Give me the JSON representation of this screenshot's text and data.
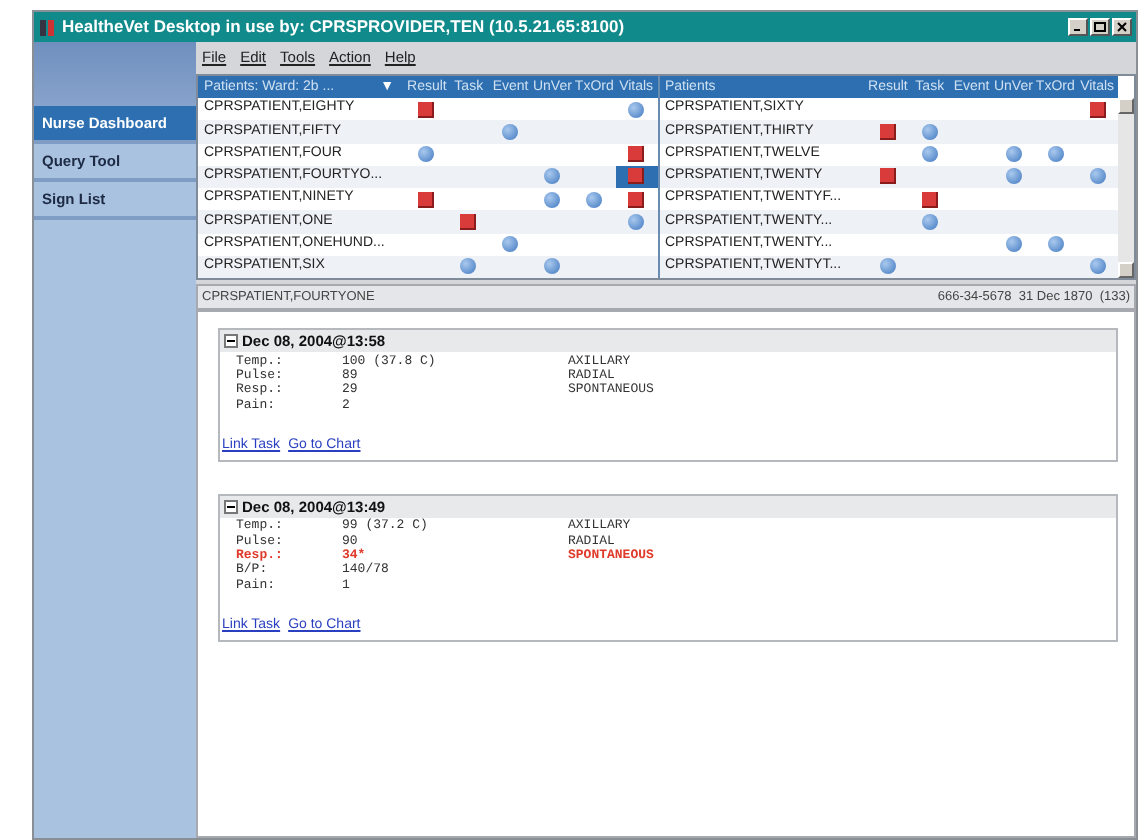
{
  "window": {
    "title": "HealtheVet Desktop in use by: CPRSPROVIDER,TEN (10.5.21.65:8100)"
  },
  "menu": [
    "File",
    "Edit",
    "Tools",
    "Action",
    "Help"
  ],
  "sidebar": {
    "items": [
      {
        "label": "Nurse Dashboard",
        "selected": true
      },
      {
        "label": "Query Tool",
        "selected": false
      },
      {
        "label": "Sign List",
        "selected": false
      }
    ]
  },
  "patient_grid": {
    "panels": [
      {
        "heading": "Patients: Ward: 2b ...",
        "dropdown": "▼",
        "columns": [
          "Result",
          "Task",
          "Event",
          "UnVer",
          "TxOrd",
          "Vitals"
        ],
        "rows": [
          {
            "name": "CPRSPATIENT,EIGHTY",
            "selected": false,
            "cells": [
              {
                "kind": "alert"
              },
              {
                "kind": "empty"
              },
              {
                "kind": "empty"
              },
              {
                "kind": "empty"
              },
              {
                "kind": "empty"
              },
              {
                "kind": "normal"
              }
            ]
          },
          {
            "name": "CPRSPATIENT,FIFTY",
            "selected": false,
            "cells": [
              {
                "kind": "empty"
              },
              {
                "kind": "empty"
              },
              {
                "kind": "normal"
              },
              {
                "kind": "empty"
              },
              {
                "kind": "empty"
              },
              {
                "kind": "empty"
              }
            ]
          },
          {
            "name": "CPRSPATIENT,FOUR",
            "selected": false,
            "cells": [
              {
                "kind": "normal"
              },
              {
                "kind": "empty"
              },
              {
                "kind": "empty"
              },
              {
                "kind": "empty"
              },
              {
                "kind": "empty"
              },
              {
                "kind": "alert"
              }
            ]
          },
          {
            "name": "CPRSPATIENT,FOURTYO...",
            "selected": true,
            "cells": [
              {
                "kind": "empty"
              },
              {
                "kind": "empty"
              },
              {
                "kind": "empty"
              },
              {
                "kind": "normal"
              },
              {
                "kind": "empty"
              },
              {
                "kind": "alert"
              }
            ]
          },
          {
            "name": "CPRSPATIENT,NINETY",
            "selected": false,
            "cells": [
              {
                "kind": "alert"
              },
              {
                "kind": "empty"
              },
              {
                "kind": "empty"
              },
              {
                "kind": "normal"
              },
              {
                "kind": "normal"
              },
              {
                "kind": "alert"
              }
            ]
          },
          {
            "name": "CPRSPATIENT,ONE",
            "selected": false,
            "cells": [
              {
                "kind": "empty"
              },
              {
                "kind": "alert"
              },
              {
                "kind": "empty"
              },
              {
                "kind": "empty"
              },
              {
                "kind": "empty"
              },
              {
                "kind": "normal"
              }
            ]
          },
          {
            "name": "CPRSPATIENT,ONEHUND...",
            "selected": false,
            "cells": [
              {
                "kind": "empty"
              },
              {
                "kind": "empty"
              },
              {
                "kind": "normal"
              },
              {
                "kind": "empty"
              },
              {
                "kind": "empty"
              },
              {
                "kind": "empty"
              }
            ]
          },
          {
            "name": "CPRSPATIENT,SIX",
            "selected": false,
            "cells": [
              {
                "kind": "empty"
              },
              {
                "kind": "normal"
              },
              {
                "kind": "empty"
              },
              {
                "kind": "normal"
              },
              {
                "kind": "empty"
              },
              {
                "kind": "empty"
              }
            ]
          }
        ]
      },
      {
        "heading": "Patients",
        "columns": [
          "Result",
          "Task",
          "Event",
          "UnVer",
          "TxOrd",
          "Vitals"
        ],
        "rows": [
          {
            "name": "CPRSPATIENT,SIXTY",
            "selected": false,
            "cells": [
              {
                "kind": "empty"
              },
              {
                "kind": "empty"
              },
              {
                "kind": "empty"
              },
              {
                "kind": "empty"
              },
              {
                "kind": "empty"
              },
              {
                "kind": "alert"
              }
            ]
          },
          {
            "name": "CPRSPATIENT,THIRTY",
            "selected": false,
            "cells": [
              {
                "kind": "alert"
              },
              {
                "kind": "normal"
              },
              {
                "kind": "empty"
              },
              {
                "kind": "empty"
              },
              {
                "kind": "empty"
              },
              {
                "kind": "empty"
              }
            ]
          },
          {
            "name": "CPRSPATIENT,TWELVE",
            "selected": false,
            "cells": [
              {
                "kind": "empty"
              },
              {
                "kind": "normal"
              },
              {
                "kind": "empty"
              },
              {
                "kind": "normal"
              },
              {
                "kind": "normal"
              },
              {
                "kind": "empty"
              }
            ]
          },
          {
            "name": "CPRSPATIENT,TWENTY",
            "selected": false,
            "cells": [
              {
                "kind": "alert"
              },
              {
                "kind": "empty"
              },
              {
                "kind": "empty"
              },
              {
                "kind": "normal"
              },
              {
                "kind": "empty"
              },
              {
                "kind": "normal"
              }
            ]
          },
          {
            "name": "CPRSPATIENT,TWENTYF...",
            "selected": false,
            "cells": [
              {
                "kind": "empty"
              },
              {
                "kind": "alert"
              },
              {
                "kind": "empty"
              },
              {
                "kind": "empty"
              },
              {
                "kind": "empty"
              },
              {
                "kind": "empty"
              }
            ]
          },
          {
            "name": "CPRSPATIENT,TWENTY...",
            "selected": false,
            "cells": [
              {
                "kind": "empty"
              },
              {
                "kind": "normal"
              },
              {
                "kind": "empty"
              },
              {
                "kind": "empty"
              },
              {
                "kind": "empty"
              },
              {
                "kind": "empty"
              }
            ]
          },
          {
            "name": "CPRSPATIENT,TWENTY...",
            "selected": false,
            "cells": [
              {
                "kind": "empty"
              },
              {
                "kind": "empty"
              },
              {
                "kind": "empty"
              },
              {
                "kind": "normal"
              },
              {
                "kind": "normal"
              },
              {
                "kind": "empty"
              }
            ]
          },
          {
            "name": "CPRSPATIENT,TWENTYT...",
            "selected": false,
            "cells": [
              {
                "kind": "normal"
              },
              {
                "kind": "empty"
              },
              {
                "kind": "empty"
              },
              {
                "kind": "empty"
              },
              {
                "kind": "empty"
              },
              {
                "kind": "normal"
              }
            ]
          }
        ]
      }
    ]
  },
  "patient_bar": {
    "name": "CPRSPATIENT,FOURTYONE",
    "details": "666-34-5678  31 Dec 1870  (133)"
  },
  "entries": [
    {
      "date": "Dec 08, 2004@13:58",
      "expanded": true,
      "vitals": [
        {
          "label": "Temp.:",
          "value": "100 (37.8 C)",
          "detail": "AXILLARY",
          "abnormal": false
        },
        {
          "label": "Pulse:",
          "value": "89",
          "detail": "RADIAL",
          "abnormal": false
        },
        {
          "label": "Resp.:",
          "value": "29",
          "detail": "SPONTANEOUS",
          "abnormal": false
        },
        {
          "label": "Pain:",
          "value": "2",
          "abnormal": false
        }
      ],
      "links": [
        "Link Task",
        "Go to Chart"
      ]
    },
    {
      "date": "Dec 08, 2004@13:49",
      "expanded": true,
      "vitals": [
        {
          "label": "Temp.:",
          "value": "99 (37.2 C)",
          "detail": "AXILLARY",
          "abnormal": false
        },
        {
          "label": "Pulse:",
          "value": "90",
          "detail": "RADIAL",
          "abnormal": false
        },
        {
          "label": "Resp.:",
          "value": "34*",
          "detail": "SPONTANEOUS",
          "abnormal": true
        },
        {
          "label": "B/P:",
          "value": "140/78",
          "abnormal": false
        },
        {
          "label": "Pain:",
          "value": "1",
          "abnormal": false
        }
      ],
      "links": [
        "Link Task",
        "Go to Chart"
      ]
    }
  ]
}
